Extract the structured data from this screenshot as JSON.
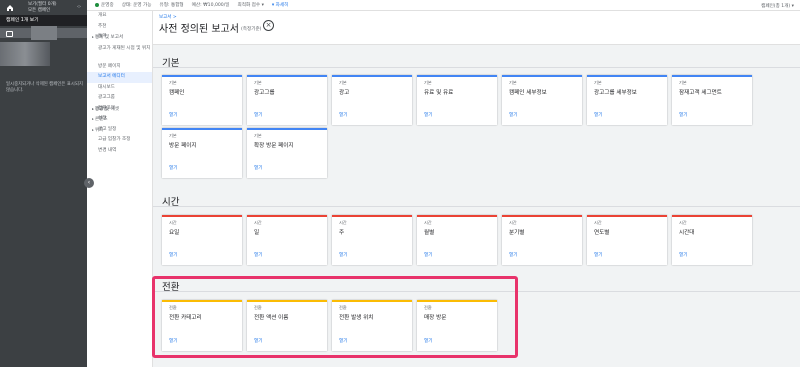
{
  "account": {
    "top_line1": "보기(필터 0개)",
    "top_line2": "모든 캠페인",
    "tab": "캠페인 1개 보기",
    "note": "일시중지되거나 삭제된 캠페인은 표시되지 않습니다."
  },
  "topbar": {
    "status": "운영중",
    "policy": "상태: 운영 가능",
    "type": "유형: 통합형",
    "budget": "예산: ₩10,000/일",
    "bidding": "최적화 점수 ▾",
    "details": "▾ 자세히",
    "date_range": "캠페인(총 1개) ▾"
  },
  "nav": {
    "items": [
      {
        "label": "개요",
        "kind": "plain"
      },
      {
        "label": "추천",
        "kind": "plain"
      },
      {
        "label": "통계 및 보고서",
        "kind": "section"
      },
      {
        "label": "통계",
        "kind": "plain"
      },
      {
        "label": "광고가 게재된 시점 및 위치",
        "kind": "tall"
      },
      {
        "label": "방문 페이지",
        "kind": "plain"
      },
      {
        "label": "보고서 에디터",
        "kind": "active"
      },
      {
        "label": "대시보드",
        "kind": "plain"
      },
      {
        "label": "광고그룹",
        "kind": "plain"
      },
      {
        "label": "광고 및 애셋",
        "kind": "section"
      },
      {
        "label": "동영상",
        "kind": "section"
      },
      {
        "label": "잠재고객",
        "kind": "plain"
      },
      {
        "label": "콘텐츠",
        "kind": "section"
      },
      {
        "label": "설정",
        "kind": "plain"
      },
      {
        "label": "위치",
        "kind": "section"
      },
      {
        "label": "광고 일정",
        "kind": "plain"
      },
      {
        "label": "고급 입찰가 조정",
        "kind": "plain"
      },
      {
        "label": "변경 내역",
        "kind": "plain"
      }
    ]
  },
  "page": {
    "breadcrumb": "보고서 >",
    "title": "사전 정의된 보고서",
    "subtitle": "(측정기준)"
  },
  "sections": [
    {
      "title": "기본",
      "kind": "basic",
      "cards": [
        {
          "category": "기본",
          "name": "캠페인",
          "open": "열기"
        },
        {
          "category": "기본",
          "name": "광고그룹",
          "open": "열기"
        },
        {
          "category": "기본",
          "name": "광고",
          "open": "열기"
        },
        {
          "category": "기본",
          "name": "유료 및 유료",
          "open": "열기"
        },
        {
          "category": "기본",
          "name": "캠페인 세부정보",
          "open": "열기"
        },
        {
          "category": "기본",
          "name": "광고그룹 세부정보",
          "open": "열기"
        },
        {
          "category": "기본",
          "name": "잠재고객 세그먼트",
          "open": "열기"
        },
        {
          "category": "기본",
          "name": "방문 페이지",
          "open": "열기"
        },
        {
          "category": "기본",
          "name": "확장 방문 페이지",
          "open": "열기"
        }
      ]
    },
    {
      "title": "시간",
      "kind": "time",
      "cards": [
        {
          "category": "시간",
          "name": "요일",
          "open": "열기"
        },
        {
          "category": "시간",
          "name": "일",
          "open": "열기"
        },
        {
          "category": "시간",
          "name": "주",
          "open": "열기"
        },
        {
          "category": "시간",
          "name": "월별",
          "open": "열기"
        },
        {
          "category": "시간",
          "name": "분기별",
          "open": "열기"
        },
        {
          "category": "시간",
          "name": "연도별",
          "open": "열기"
        },
        {
          "category": "시간",
          "name": "시간대",
          "open": "열기"
        }
      ]
    },
    {
      "title": "전환",
      "kind": "conv",
      "cards": [
        {
          "category": "전환",
          "name": "전환 카테고리",
          "open": "열기"
        },
        {
          "category": "전환",
          "name": "전환 액션 이름",
          "open": "열기"
        },
        {
          "category": "전환",
          "name": "전환 발생 위치",
          "open": "열기"
        },
        {
          "category": "전환",
          "name": "매장 방문",
          "open": "열기"
        }
      ]
    }
  ]
}
